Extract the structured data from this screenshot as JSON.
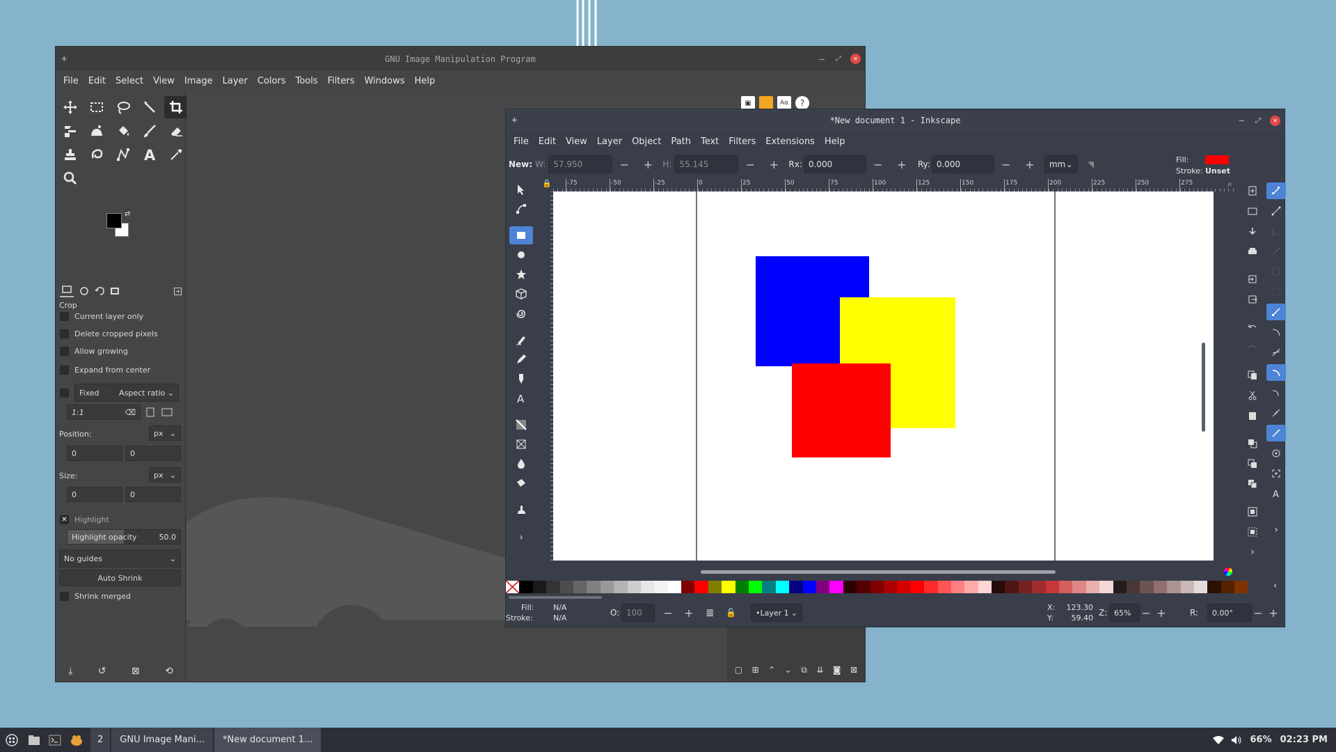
{
  "gimp": {
    "title": "GNU Image Manipulation Program",
    "menu": [
      "File",
      "Edit",
      "Select",
      "View",
      "Image",
      "Layer",
      "Colors",
      "Tools",
      "Filters",
      "Windows",
      "Help"
    ],
    "tool_options": {
      "heading": "Crop",
      "current_layer_only": "Current layer only",
      "delete_cropped": "Delete cropped pixels",
      "allow_growing": "Allow growing",
      "expand_from_center": "Expand from center",
      "fixed_label": "Fixed",
      "fixed_mode": "Aspect ratio",
      "ratio_value": "1:1",
      "position_label": "Position:",
      "position_unit": "px",
      "position_x": "0",
      "position_y": "0",
      "size_label": "Size:",
      "size_unit": "px",
      "size_w": "0",
      "size_h": "0",
      "highlight": "Highlight",
      "highlight_opacity_label": "Highlight opacity",
      "highlight_opacity_value": "50.0",
      "guides": "No guides",
      "auto_shrink": "Auto Shrink",
      "shrink_merged": "Shrink merged"
    }
  },
  "inkscape": {
    "title": "*New document 1 - Inkscape",
    "menu": [
      "File",
      "Edit",
      "View",
      "Layer",
      "Object",
      "Path",
      "Text",
      "Filters",
      "Extensions",
      "Help"
    ],
    "toolbar": {
      "new_label": "New:",
      "w_label": "W:",
      "w_value": "57.950",
      "h_label": "H:",
      "h_value": "55.145",
      "rx_label": "Rx:",
      "rx_value": "0.000",
      "ry_label": "Ry:",
      "ry_value": "0.000",
      "unit": "mm",
      "fill_label": "Fill:",
      "stroke_label": "Stroke:",
      "stroke_value": "Unset"
    },
    "ruler_ticks": [
      "-75",
      "-50",
      "-25",
      "0",
      "25",
      "50",
      "75",
      "100",
      "125",
      "150",
      "175",
      "200",
      "225",
      "250",
      "275"
    ],
    "status": {
      "fill_label": "Fill:",
      "fill_value": "N/A",
      "stroke_label": "Stroke:",
      "stroke_value": "N/A",
      "opacity_label": "O:",
      "opacity_value": "100",
      "layer": "•Layer 1",
      "x_label": "X:",
      "x_value": "123.30",
      "y_label": "Y:",
      "y_value": "59.40",
      "zoom_label": "Z:",
      "zoom_value": "65%",
      "rotate_label": "R:",
      "rotate_value": "0.00°"
    },
    "shapes_colors": {
      "blue": "#0000ff",
      "yellow": "#ffff00",
      "red": "#ff0000"
    },
    "palette": [
      "#000000",
      "#1a1a1a",
      "#333333",
      "#4d4d4d",
      "#666666",
      "#808080",
      "#999999",
      "#b3b3b3",
      "#cccccc",
      "#e6e6e6",
      "#f2f2f2",
      "#ffffff",
      "#800000",
      "#ff0000",
      "#808000",
      "#ffff00",
      "#008000",
      "#00ff00",
      "#008080",
      "#00ffff",
      "#000080",
      "#0000ff",
      "#800080",
      "#ff00ff",
      "#2b0000",
      "#550000",
      "#800000",
      "#aa0000",
      "#d40000",
      "#ff0000",
      "#ff2a2a",
      "#ff5555",
      "#ff8080",
      "#ffaaaa",
      "#ffd5d5",
      "#280b0b",
      "#501616",
      "#782121",
      "#a02c2c",
      "#c83737",
      "#d35f5f",
      "#de8787",
      "#e9afaf",
      "#f4d7d7",
      "#241c1c",
      "#483737",
      "#6c5353",
      "#916f6f",
      "#ac9393",
      "#c8b7b7",
      "#e3dbdb",
      "#2b1100",
      "#552200",
      "#803300"
    ]
  },
  "taskbar": {
    "workspace": "2",
    "tasks": [
      "GNU Image Mani...",
      "*New document 1..."
    ],
    "battery": "66%",
    "time": "02:23 PM"
  }
}
